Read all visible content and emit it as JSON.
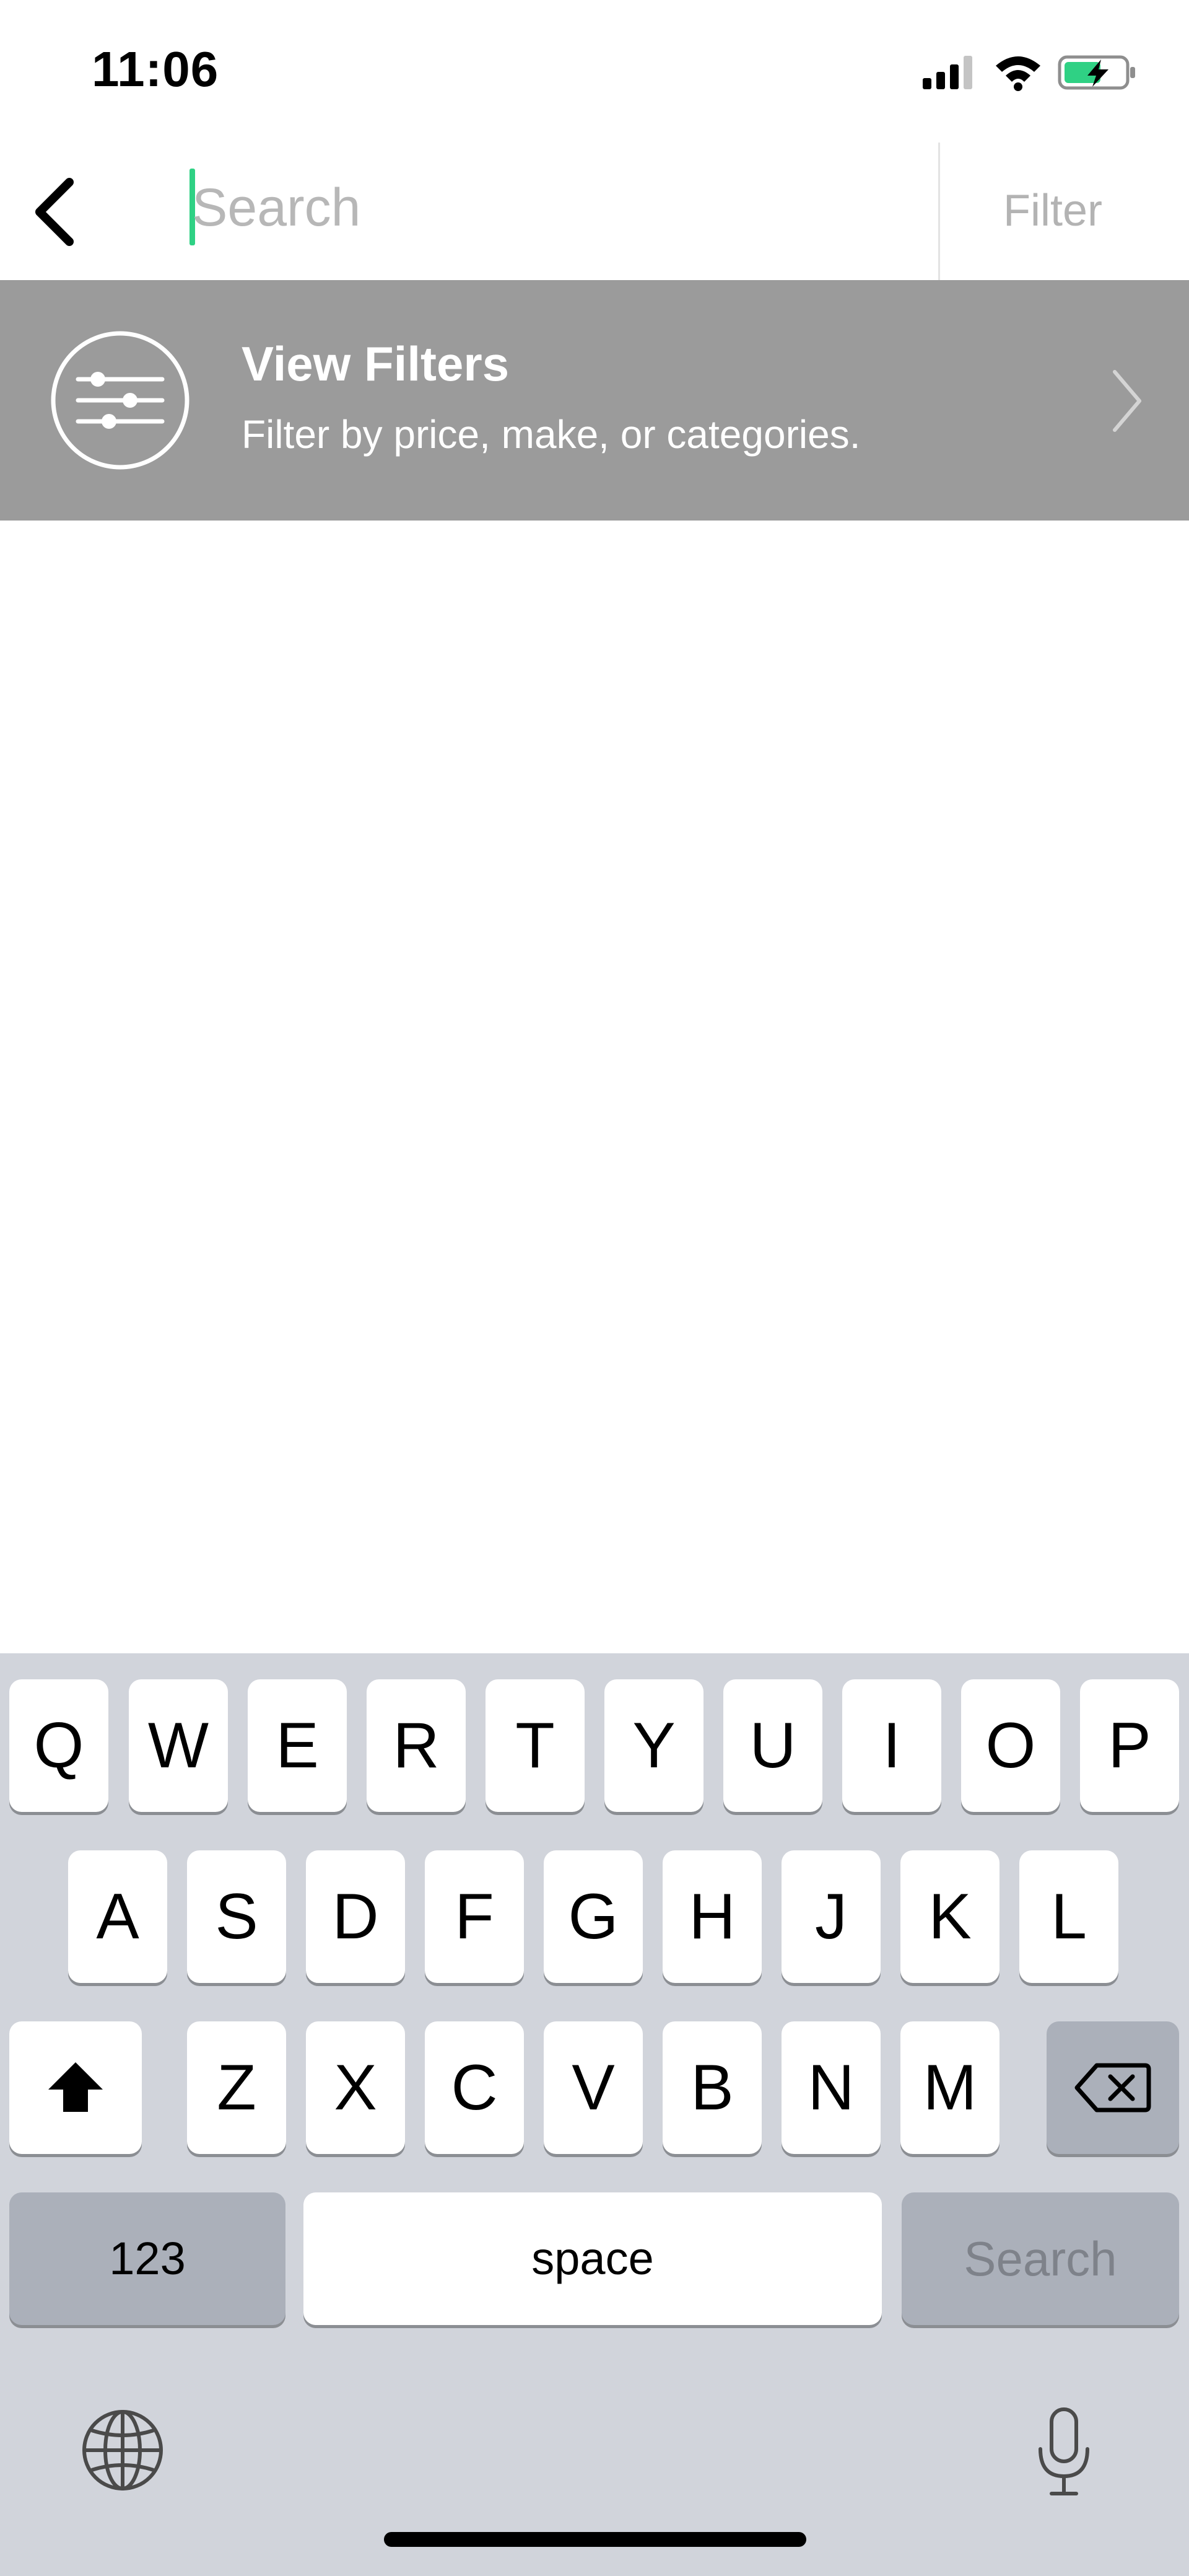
{
  "status_bar": {
    "time": "11:06",
    "battery_color": "#2fd184"
  },
  "search": {
    "placeholder": "Search",
    "value": "",
    "filter_label": "Filter",
    "cursor_color": "#2fd184"
  },
  "filters_banner": {
    "title": "View Filters",
    "subtitle": "Filter by price, make, or categories.",
    "background": "#9b9b9b"
  },
  "keyboard": {
    "row1": [
      "Q",
      "W",
      "E",
      "R",
      "T",
      "Y",
      "U",
      "I",
      "O",
      "P"
    ],
    "row2": [
      "A",
      "S",
      "D",
      "F",
      "G",
      "H",
      "J",
      "K",
      "L"
    ],
    "row3": [
      "Z",
      "X",
      "C",
      "V",
      "B",
      "N",
      "M"
    ],
    "numbers_label": "123",
    "space_label": "space",
    "search_label": "Search",
    "icons": [
      "shift-icon",
      "delete-icon",
      "globe-icon",
      "microphone-icon"
    ]
  }
}
